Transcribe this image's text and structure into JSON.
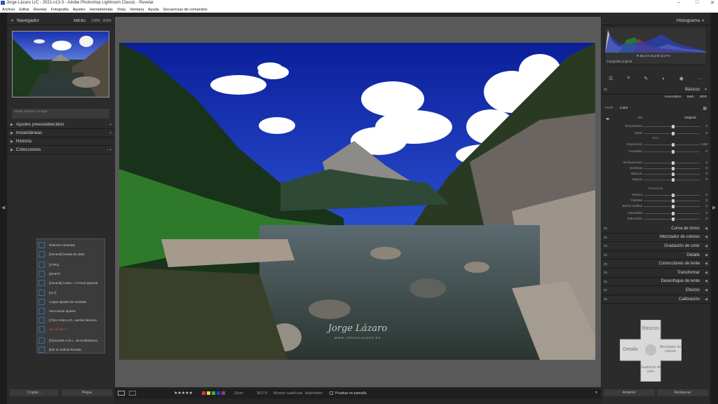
{
  "window": {
    "title": "Jorge Lázaro LrC - 2021-v13-3 - Adobe Photoshop Lightroom Classic - Revelar",
    "controls": [
      "–",
      "□",
      "✕"
    ]
  },
  "menu": [
    "Archivo",
    "Editar",
    "Revelar",
    "Fotografía",
    "Ajustes",
    "Herramientas",
    "Vista",
    "Ventana",
    "Ayuda",
    "Secuencias de comandos"
  ],
  "left": {
    "navigator": {
      "title": "Navegador",
      "zoom": [
        "ENCAJ.",
        "100%",
        "200%"
      ]
    },
    "fit_text": "Ajuste perfecto / Imagen",
    "panels": [
      "Ajustes preestablecidos",
      "Instantáneas",
      "Historia",
      "Colecciones"
    ],
    "hud": {
      "rows": [
        {
          "label": "Reducir/ Aumentar",
          "red": false
        },
        {
          "label": "[General] Rueda de ratón",
          "red": false
        },
        {
          "label": "[CTRL]",
          "red": false
        },
        {
          "label": "[SHIFT]",
          "red": false
        },
        {
          "label": "[General] Activa...r el HUD general",
          "red": false
        },
        {
          "label": "[ALT]",
          "red": false
        },
        {
          "label": "Copiar ajustes de revelado",
          "red": false
        },
        {
          "label": "Sincronizar ajustes",
          "red": false
        },
        {
          "label": "[Y]Ver Antes y D...uierda/ derecha",
          "red": false
        },
        {
          "label": "Ver sin filtros",
          "red": true
        },
        {
          "label": "[G]Acceder a la c...de la Biblioteca",
          "red": false
        },
        {
          "label": "[D]Ir al módulo Revelar",
          "red": false
        }
      ]
    },
    "buttons": {
      "copy": "Copiar...",
      "paste": "Pegar"
    }
  },
  "center": {
    "watermark": "Jorge Lázaro",
    "watermark_sub": "WWW.JORGELAZARO.ES",
    "toolbar": {
      "stars": "★★★★★",
      "zoom_label": "Zoom",
      "zoom_value": "38.5 %",
      "cmp_label": "Mostrar cuadrícula",
      "auto": "Automático",
      "proof": "Pruebas en pantalla",
      "flag_colors": [
        "#d33",
        "#dd3",
        "#3b3",
        "#33c",
        "#939"
      ]
    }
  },
  "right": {
    "histogram": {
      "title": "Histograma",
      "readout": "R 26,3  G 34,2  B 12,0 %",
      "original": "Fotografía original"
    },
    "basics": {
      "title": "Básicos",
      "modes": [
        "Automático",
        "B&N",
        "HDR"
      ],
      "treatment_label": "Perfil",
      "treatment": "Color",
      "wb_label": "EB",
      "wb_value": "Original",
      "group_tone": "Tono",
      "group_presence": "Presencia",
      "rows": [
        {
          "label": "Temperatura",
          "value": "0",
          "pos": 0.5
        },
        {
          "label": "Matiz",
          "value": "0",
          "pos": 0.5
        },
        {
          "label": "Exposición",
          "value": "0,00",
          "pos": 0.5
        },
        {
          "label": "Contraste",
          "value": "0",
          "pos": 0.5
        },
        {
          "label": "Iluminaciones",
          "value": "0",
          "pos": 0.5
        },
        {
          "label": "Sombras",
          "value": "0",
          "pos": 0.5
        },
        {
          "label": "Blancos",
          "value": "0",
          "pos": 0.5
        },
        {
          "label": "Negros",
          "value": "0",
          "pos": 0.5
        },
        {
          "label": "Textura",
          "value": "0",
          "pos": 0.5
        },
        {
          "label": "Claridad",
          "value": "0",
          "pos": 0.5
        },
        {
          "label": "Borrar neblina",
          "value": "0",
          "pos": 0.5
        },
        {
          "label": "Intensidad",
          "value": "0",
          "pos": 0.5
        },
        {
          "label": "Saturación",
          "value": "0",
          "pos": 0.5
        }
      ]
    },
    "sections": [
      "Curva de tonos",
      "Mezclador de colores",
      "Gradación de color",
      "Detalle",
      "Correcciones de lente",
      "Transformar",
      "Desenfoque de lente",
      "Efectos",
      "Calibración"
    ],
    "dpad": {
      "top": "Básicos",
      "left": "Detalle",
      "right": "Mezclador de colores",
      "bottom": "Gradación de color"
    },
    "buttons": {
      "prev": "Anterior",
      "reset": "Restaurar"
    }
  }
}
